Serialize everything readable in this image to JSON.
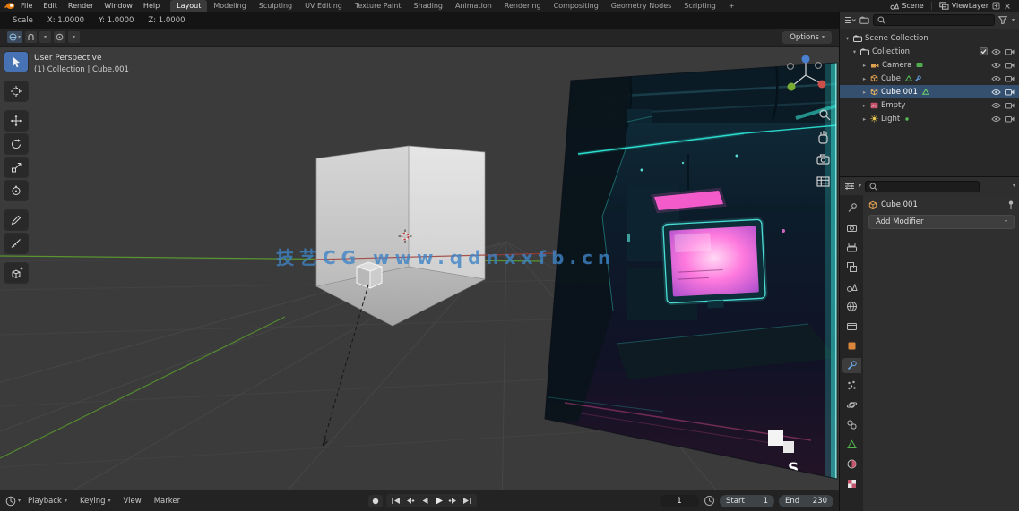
{
  "topbar": {
    "menus": [
      "File",
      "Edit",
      "Render",
      "Window",
      "Help"
    ],
    "tabs": [
      "Layout",
      "Modeling",
      "Sculpting",
      "UV Editing",
      "Texture Paint",
      "Shading",
      "Animation",
      "Rendering",
      "Compositing",
      "Geometry Nodes",
      "Scripting",
      "+"
    ],
    "active_tab": "Layout",
    "scene_label": "Scene",
    "view_layer_label": "ViewLayer"
  },
  "redo_panel": {
    "title": "Scale",
    "x": "X: 1.0000",
    "y": "Y: 1.0000",
    "z": "Z: 1.0000"
  },
  "viewport": {
    "header": {
      "options_label": "Options"
    },
    "overlay": {
      "view_label": "User Perspective",
      "context_label": "(1) Collection | Cube.001"
    },
    "watermark": "技艺CG  www.qdnxxfb.cn",
    "image_text": "S"
  },
  "outliner": {
    "search_value": "",
    "rows": [
      {
        "label": "Scene Collection"
      },
      {
        "label": "Collection",
        "checked": true
      },
      {
        "label": "Camera"
      },
      {
        "label": "Cube"
      },
      {
        "label": "Cube.001",
        "selected": true
      },
      {
        "label": "Empty"
      },
      {
        "label": "Light"
      }
    ]
  },
  "properties": {
    "search_value": "",
    "active_object": "Cube.001",
    "add_modifier_label": "Add Modifier",
    "active_tab": "modifiers"
  },
  "timeline": {
    "menus": [
      "Playback",
      "Keying",
      "View",
      "Marker"
    ],
    "current_frame": "1",
    "start_label": "Start",
    "start_value": "1",
    "end_label": "End",
    "end_value": "230"
  },
  "icons": {
    "search": "magnifier",
    "filter": "funnel",
    "dropdown": "chevron-down",
    "visibility": "eye",
    "render_visibility": "camera",
    "pin": "pushpin",
    "tools": [
      "select-box",
      "cursor",
      "move",
      "rotate",
      "scale",
      "transform",
      "annotate",
      "measure",
      "add-cube"
    ]
  },
  "colors": {
    "accent": "#4772b3",
    "selection": "#35506e",
    "watermark": "#3f83c6",
    "neon_cyan": "#35e8de",
    "neon_pink": "#ff5fd2",
    "axis_green": "#5a9a2e",
    "axis_red": "#9e3d38",
    "object_orange": "#dfa051"
  }
}
